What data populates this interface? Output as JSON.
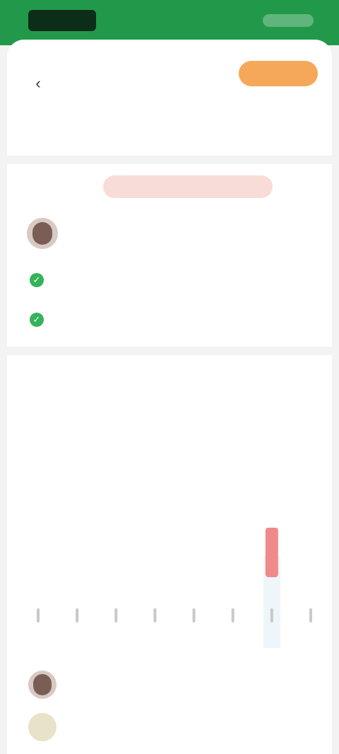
{
  "status_bar": {
    "time": "",
    "indicators": ""
  },
  "header": {
    "title": "",
    "action_button": ""
  },
  "segments": [
    {
      "label": "",
      "sublabel": ""
    },
    {
      "label": "",
      "sublabel": ""
    },
    {
      "label": "",
      "sublabel": ""
    }
  ],
  "filter": {
    "label": "",
    "pill": ""
  },
  "info": {
    "text": ""
  },
  "checks": [
    {
      "text": ""
    },
    {
      "text": ""
    }
  ],
  "section1": {
    "title": ""
  },
  "tabs": [
    {
      "label": ""
    },
    {
      "label": ""
    },
    {
      "label": ""
    },
    {
      "label": ""
    }
  ],
  "note": "",
  "legend": {
    "label": "",
    "items": [
      "",
      ""
    ]
  },
  "chart_data": {
    "type": "bar",
    "categories": [
      "",
      "",
      "",
      "",
      "",
      "",
      "",
      ""
    ],
    "values": [
      0,
      0,
      0,
      0,
      0,
      0,
      1,
      0
    ],
    "highlight_index": 6,
    "colors": {
      "bar": "#f08a8a",
      "highlight_bg": "#eef6fb",
      "tick": "#c9c9c9"
    }
  },
  "section2": {
    "title": ""
  },
  "list": [
    {
      "text": ""
    },
    {
      "text": ""
    }
  ],
  "colors": {
    "status_green": "#22994a",
    "accent_orange": "#f6a85a",
    "pill_red": "#f8dcd8",
    "check_green": "#34b35a"
  }
}
